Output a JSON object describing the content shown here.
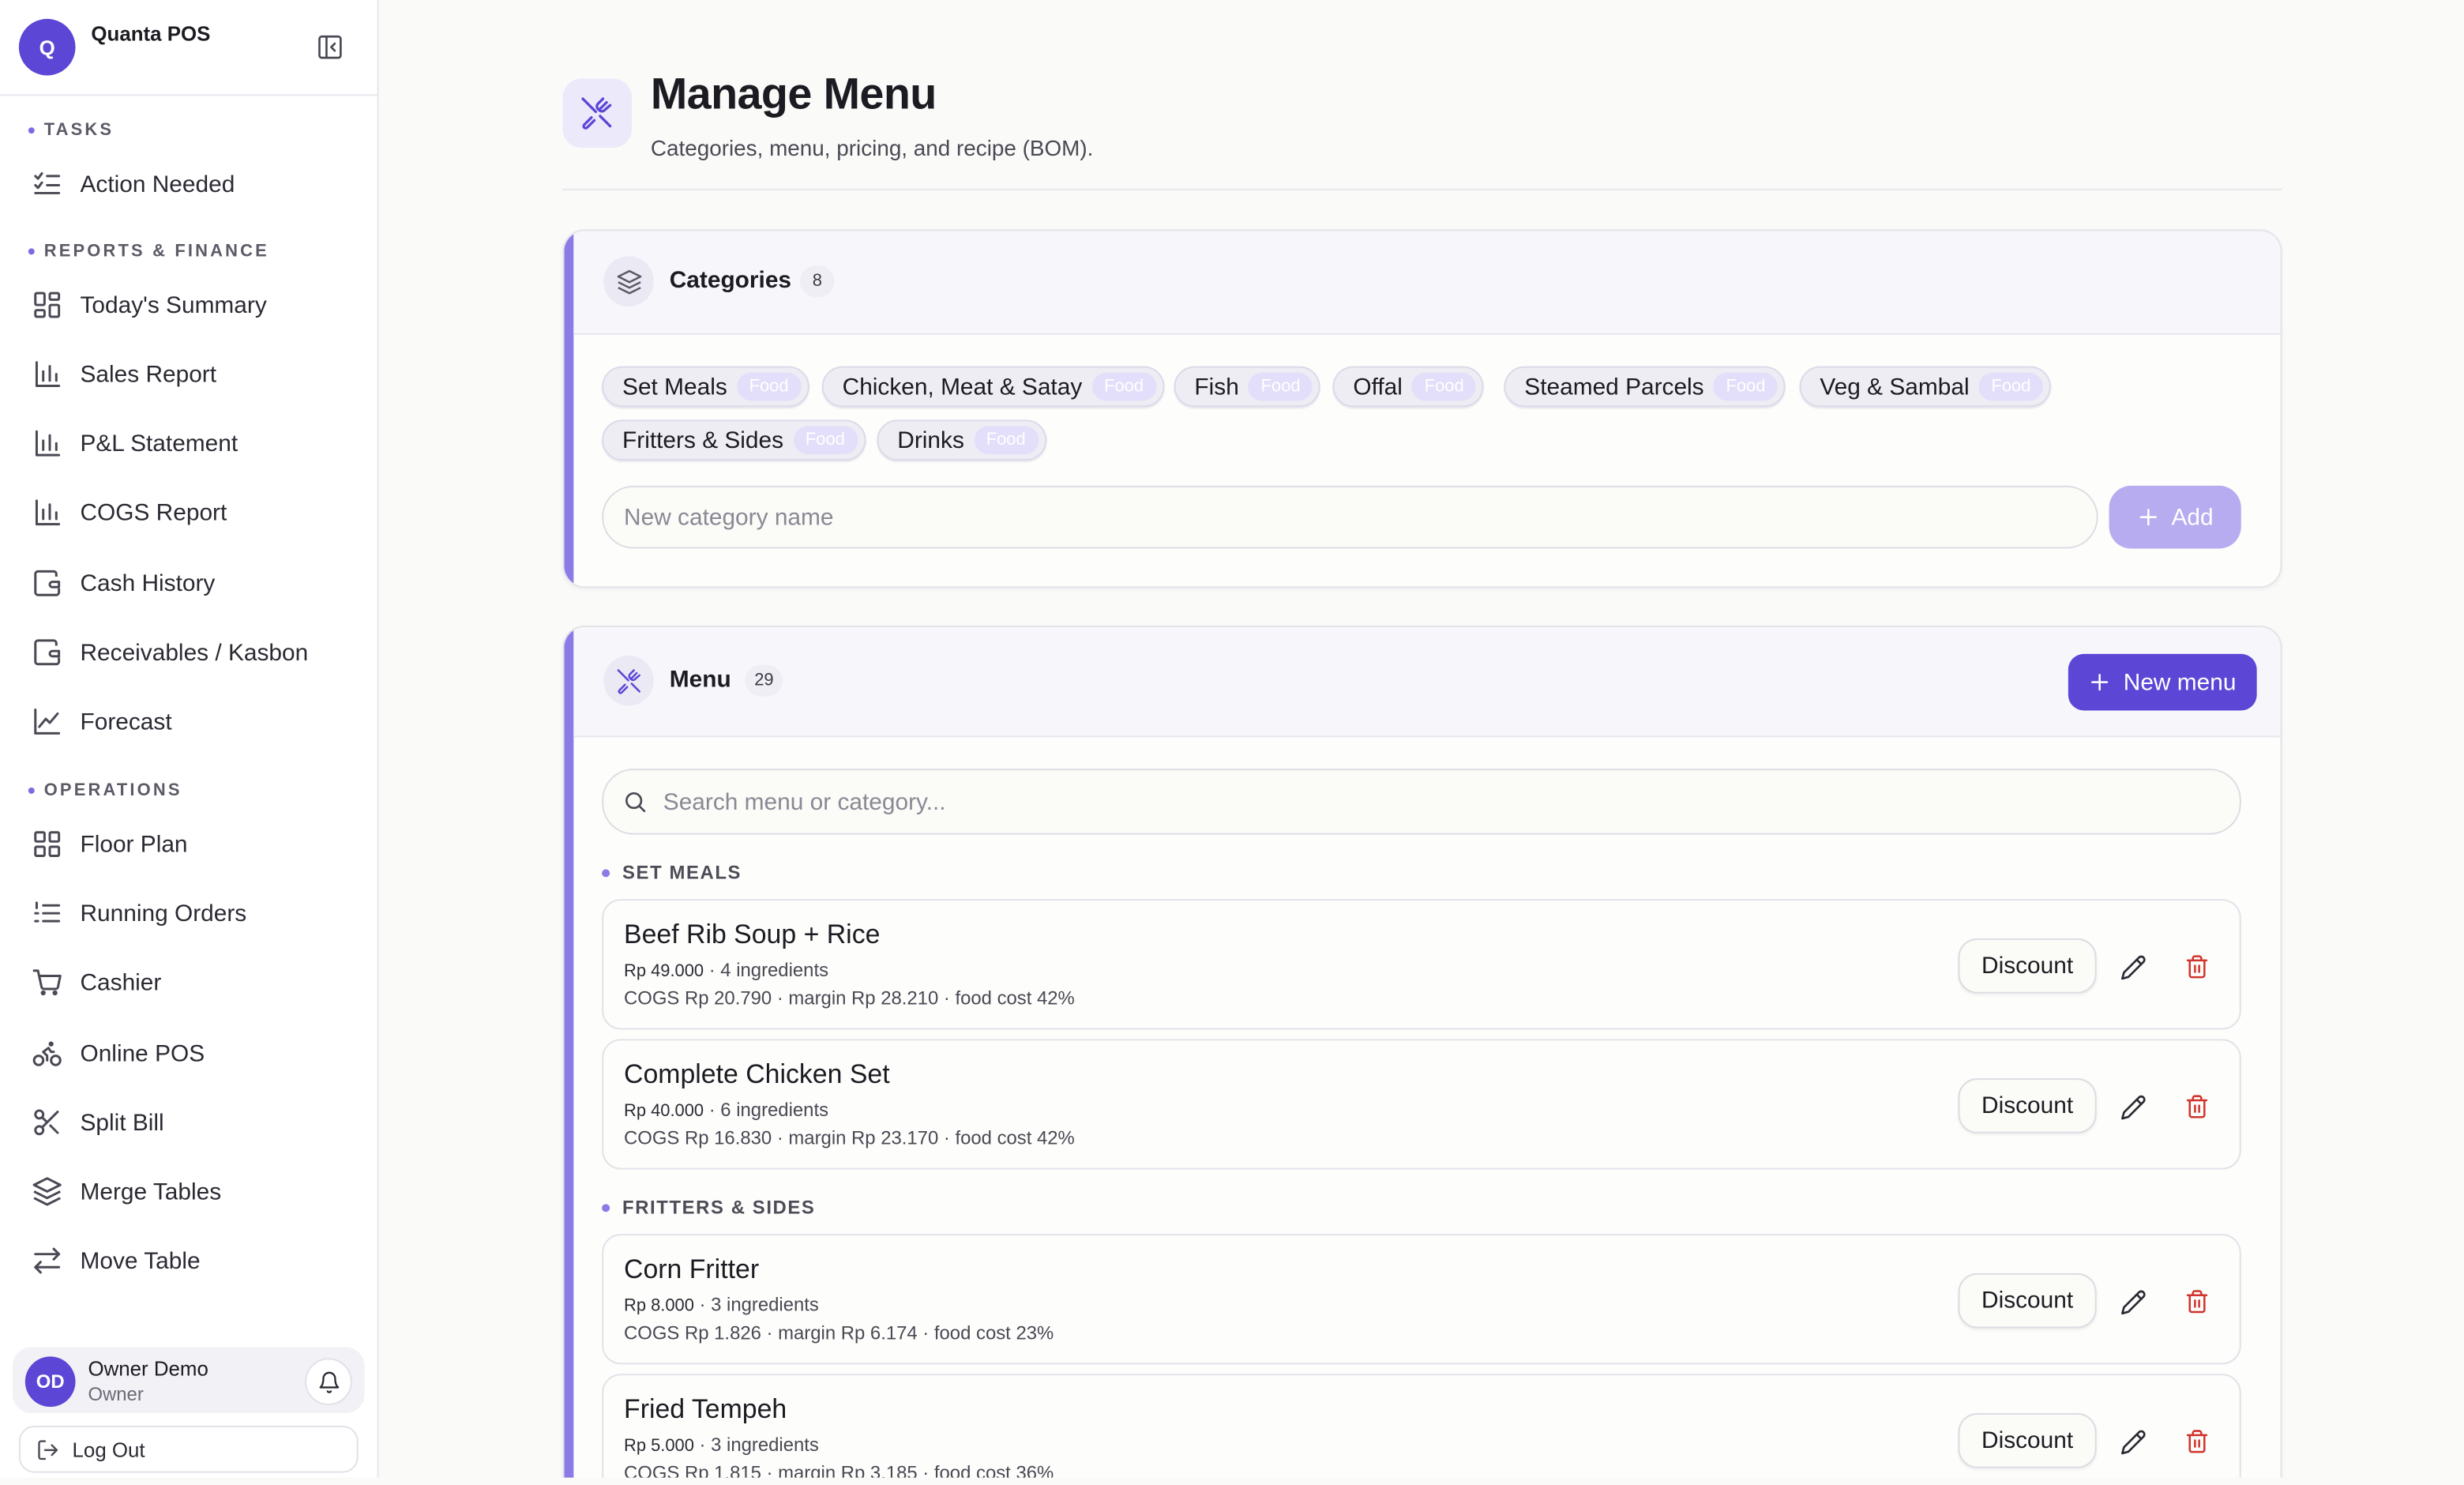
{
  "brand": {
    "initial": "Q",
    "name": "Quanta POS"
  },
  "sidebar": {
    "sections": [
      {
        "title": "TASKS",
        "items": [
          {
            "label": "Action Needed",
            "icon": "checklist-icon"
          }
        ]
      },
      {
        "title": "REPORTS & FINANCE",
        "items": [
          {
            "label": "Today's Summary",
            "icon": "dashboard-icon"
          },
          {
            "label": "Sales Report",
            "icon": "bar-chart-icon"
          },
          {
            "label": "P&L Statement",
            "icon": "bar-chart-icon"
          },
          {
            "label": "COGS Report",
            "icon": "bar-chart-icon"
          },
          {
            "label": "Cash History",
            "icon": "wallet-icon"
          },
          {
            "label": "Receivables / Kasbon",
            "icon": "wallet-icon"
          },
          {
            "label": "Forecast",
            "icon": "line-chart-icon"
          }
        ]
      },
      {
        "title": "OPERATIONS",
        "items": [
          {
            "label": "Floor Plan",
            "icon": "grid-icon"
          },
          {
            "label": "Running Orders",
            "icon": "ordered-list-icon"
          },
          {
            "label": "Cashier",
            "icon": "cart-icon"
          },
          {
            "label": "Online POS",
            "icon": "bike-icon"
          },
          {
            "label": "Split Bill",
            "icon": "scissors-icon"
          },
          {
            "label": "Merge Tables",
            "icon": "layers-icon"
          },
          {
            "label": "Move Table",
            "icon": "arrows-swap-icon"
          }
        ]
      }
    ],
    "user": {
      "initials": "OD",
      "name": "Owner Demo",
      "role": "Owner"
    },
    "logout_label": "Log Out"
  },
  "page": {
    "title": "Manage Menu",
    "subtitle": "Categories, menu, pricing, and recipe (BOM)."
  },
  "categories": {
    "title": "Categories",
    "count": "8",
    "items": [
      {
        "name": "Set Meals",
        "tag": "Food"
      },
      {
        "name": "Chicken, Meat & Satay",
        "tag": "Food"
      },
      {
        "name": "Fish",
        "tag": "Food"
      },
      {
        "name": "Offal",
        "tag": "Food"
      },
      {
        "name": "Steamed Parcels",
        "tag": "Food"
      },
      {
        "name": "Veg & Sambal",
        "tag": "Food"
      },
      {
        "name": "Fritters & Sides",
        "tag": "Food"
      },
      {
        "name": "Drinks",
        "tag": "Food"
      }
    ],
    "input_placeholder": "New category name",
    "add_label": "Add"
  },
  "menu": {
    "title": "Menu",
    "count": "29",
    "new_menu_label": "New menu",
    "search_placeholder": "Search menu or category...",
    "groups": [
      {
        "title": "SET MEALS",
        "items": [
          {
            "name": "Beef Rib Soup + Rice",
            "price": "Rp 49.000",
            "ingredients": "· 4 ingredients",
            "cogs": "COGS Rp 20.790 · margin Rp 28.210 · food cost 42%"
          },
          {
            "name": "Complete Chicken Set",
            "price": "Rp 40.000",
            "ingredients": "· 6 ingredients",
            "cogs": "COGS Rp 16.830 · margin Rp 23.170 · food cost 42%"
          }
        ]
      },
      {
        "title": "FRITTERS & SIDES",
        "items": [
          {
            "name": "Corn Fritter",
            "price": "Rp 8.000",
            "ingredients": "· 3 ingredients",
            "cogs": "COGS Rp 1.826 · margin Rp 6.174 · food cost 23%"
          },
          {
            "name": "Fried Tempeh",
            "price": "Rp 5.000",
            "ingredients": "· 3 ingredients",
            "cogs": "COGS Rp 1.815 · margin Rp 3.185 · food cost 36%"
          }
        ]
      }
    ],
    "discount_label": "Discount"
  },
  "colors": {
    "accent": "#5b46d6",
    "accent_light": "#8b7be6",
    "danger": "#d0342c"
  }
}
